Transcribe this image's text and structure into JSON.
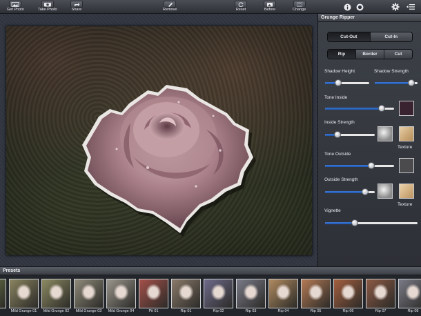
{
  "toolbar": {
    "get_photo": "Get Photo",
    "take_photo": "Take Photo",
    "share": "Share",
    "remove": "Remove",
    "reset": "Reset",
    "before": "Before",
    "change": "Change"
  },
  "panel": {
    "title": "Grunge Ripper",
    "mode_tabs": [
      {
        "label": "Cut-Out",
        "selected": true
      },
      {
        "label": "Cut-In",
        "selected": false
      }
    ],
    "edge_tabs": [
      {
        "label": "Rip",
        "selected": true
      },
      {
        "label": "Border",
        "selected": false
      },
      {
        "label": "Cut",
        "selected": false
      }
    ],
    "shadow_height": {
      "label": "Shadow Height",
      "value": 0.3
    },
    "shadow_strength": {
      "label": "Shadow Strength",
      "value": 0.85
    },
    "tone_inside": {
      "label": "Tone Inside",
      "value": 0.82,
      "color": "#3a2330"
    },
    "inside_strength": {
      "label": "Inside Strength",
      "value": 0.25,
      "texture_label": "Texture"
    },
    "tone_outside": {
      "label": "Tone Outside",
      "value": 0.67,
      "color": "#4b4b4e"
    },
    "outside_strength": {
      "label": "Outside Strength",
      "value": 0.8,
      "texture_label": "Texture"
    },
    "vignette": {
      "label": "Vignette",
      "value": 0.32
    }
  },
  "presets": {
    "title": "Presets",
    "items": [
      {
        "label": "",
        "color": "#6d7a4a"
      },
      {
        "label": "Mild Grunge 01",
        "color": "#8a8460"
      },
      {
        "label": "Mild Grunge 02",
        "color": "#8c8a62"
      },
      {
        "label": "Mild Grunge 03",
        "color": "#8f8a7a"
      },
      {
        "label": "Mild Grunge 04",
        "color": "#9a958c"
      },
      {
        "label": "Pit 01",
        "color": "#a4504a"
      },
      {
        "label": "Rip 01",
        "color": "#8a7a6a"
      },
      {
        "label": "Rip 02",
        "color": "#6e6a8a"
      },
      {
        "label": "Rip 03",
        "color": "#7a7a88"
      },
      {
        "label": "Rip 04",
        "color": "#b08a60"
      },
      {
        "label": "Rip 05",
        "color": "#b47a55"
      },
      {
        "label": "Rip 06",
        "color": "#a45f3f"
      },
      {
        "label": "Rip 07",
        "color": "#8c5a45"
      },
      {
        "label": "Rip 08",
        "color": "#7a7a86"
      }
    ]
  },
  "colors": {
    "accent": "#2f6fd0",
    "rose": "#b38790"
  },
  "icons": [
    "photo-icon",
    "camera-icon",
    "share-icon",
    "remove-icon",
    "reset-icon",
    "before-icon",
    "change-icon",
    "info-icon",
    "contrast-icon",
    "gear-icon",
    "list-icon"
  ]
}
